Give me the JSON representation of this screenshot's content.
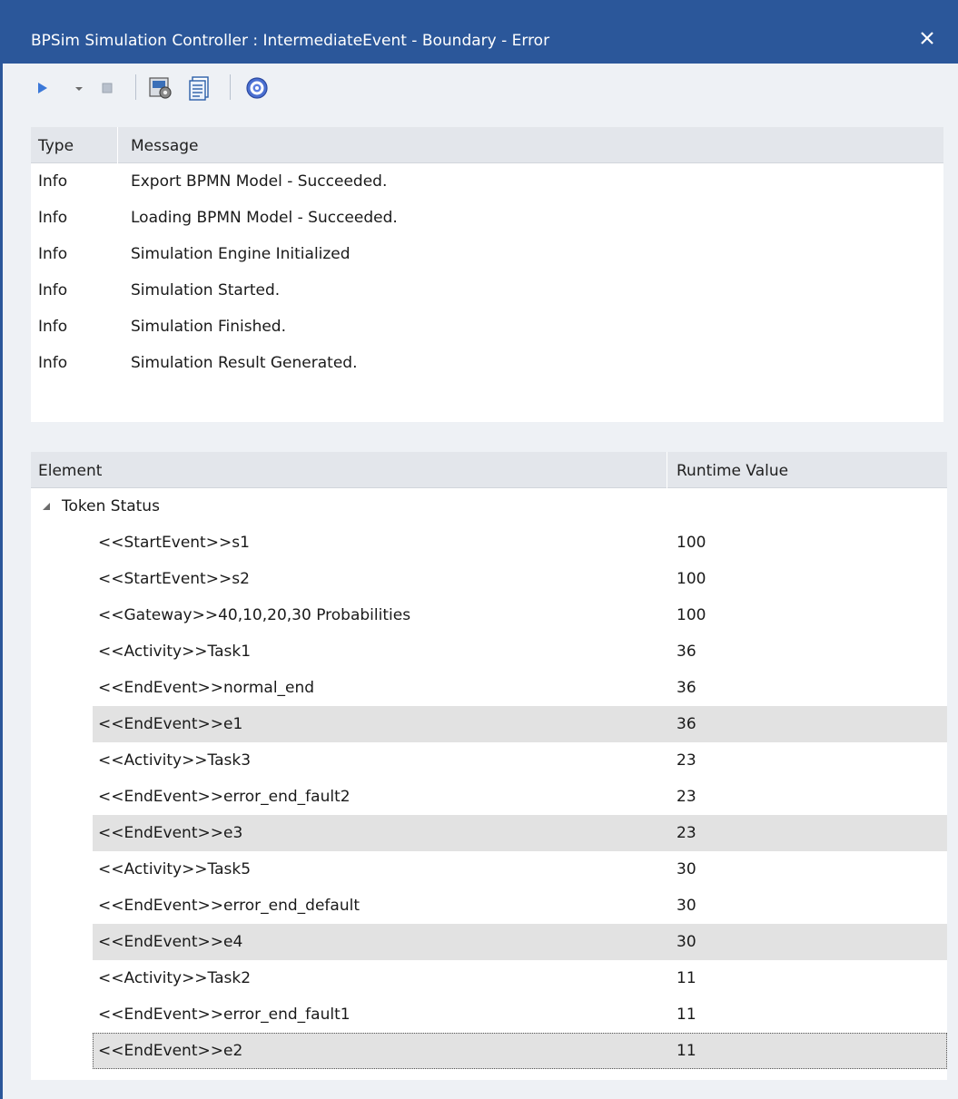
{
  "window": {
    "title": "BPSim Simulation Controller : IntermediateEvent - Boundary - Error",
    "close_icon": "close-icon",
    "accent_color": "#2b579a"
  },
  "toolbar": {
    "buttons": [
      {
        "name": "run-button",
        "icon": "play-icon"
      },
      {
        "name": "run-dropdown",
        "icon": "chevron-down-icon"
      },
      {
        "name": "stop-button",
        "icon": "stop-icon"
      },
      {
        "name": "configure-button",
        "icon": "config-icon"
      },
      {
        "name": "report-button",
        "icon": "report-icon"
      },
      {
        "name": "help-button",
        "icon": "help-icon"
      }
    ]
  },
  "messages": {
    "columns": [
      "Type",
      "Message"
    ],
    "rows": [
      {
        "type": "Info",
        "message": "Export BPMN Model - Succeeded."
      },
      {
        "type": "Info",
        "message": "Loading BPMN Model - Succeeded."
      },
      {
        "type": "Info",
        "message": "Simulation Engine Initialized"
      },
      {
        "type": "Info",
        "message": "Simulation Started."
      },
      {
        "type": "Info",
        "message": "Simulation Finished."
      },
      {
        "type": "Info",
        "message": "Simulation Result Generated."
      }
    ]
  },
  "results": {
    "columns": [
      "Element",
      "Runtime Value"
    ],
    "group": {
      "label": "Token Status",
      "expanded": true
    },
    "rows": [
      {
        "element": "<<StartEvent>>s1",
        "value": "100",
        "highlighted": false
      },
      {
        "element": "<<StartEvent>>s2",
        "value": "100",
        "highlighted": false
      },
      {
        "element": "<<Gateway>>40,10,20,30 Probabilities",
        "value": "100",
        "highlighted": false
      },
      {
        "element": "<<Activity>>Task1",
        "value": "36",
        "highlighted": false
      },
      {
        "element": "<<EndEvent>>normal_end",
        "value": "36",
        "highlighted": false
      },
      {
        "element": "<<EndEvent>>e1",
        "value": "36",
        "highlighted": true
      },
      {
        "element": "<<Activity>>Task3",
        "value": "23",
        "highlighted": false
      },
      {
        "element": "<<EndEvent>>error_end_fault2",
        "value": "23",
        "highlighted": false
      },
      {
        "element": "<<EndEvent>>e3",
        "value": "23",
        "highlighted": true
      },
      {
        "element": "<<Activity>>Task5",
        "value": "30",
        "highlighted": false
      },
      {
        "element": "<<EndEvent>>error_end_default",
        "value": "30",
        "highlighted": false
      },
      {
        "element": "<<EndEvent>>e4",
        "value": "30",
        "highlighted": true
      },
      {
        "element": "<<Activity>>Task2",
        "value": "11",
        "highlighted": false
      },
      {
        "element": "<<EndEvent>>error_end_fault1",
        "value": "11",
        "highlighted": false
      },
      {
        "element": "<<EndEvent>>e2",
        "value": "11",
        "highlighted": true,
        "focused": true
      }
    ]
  }
}
